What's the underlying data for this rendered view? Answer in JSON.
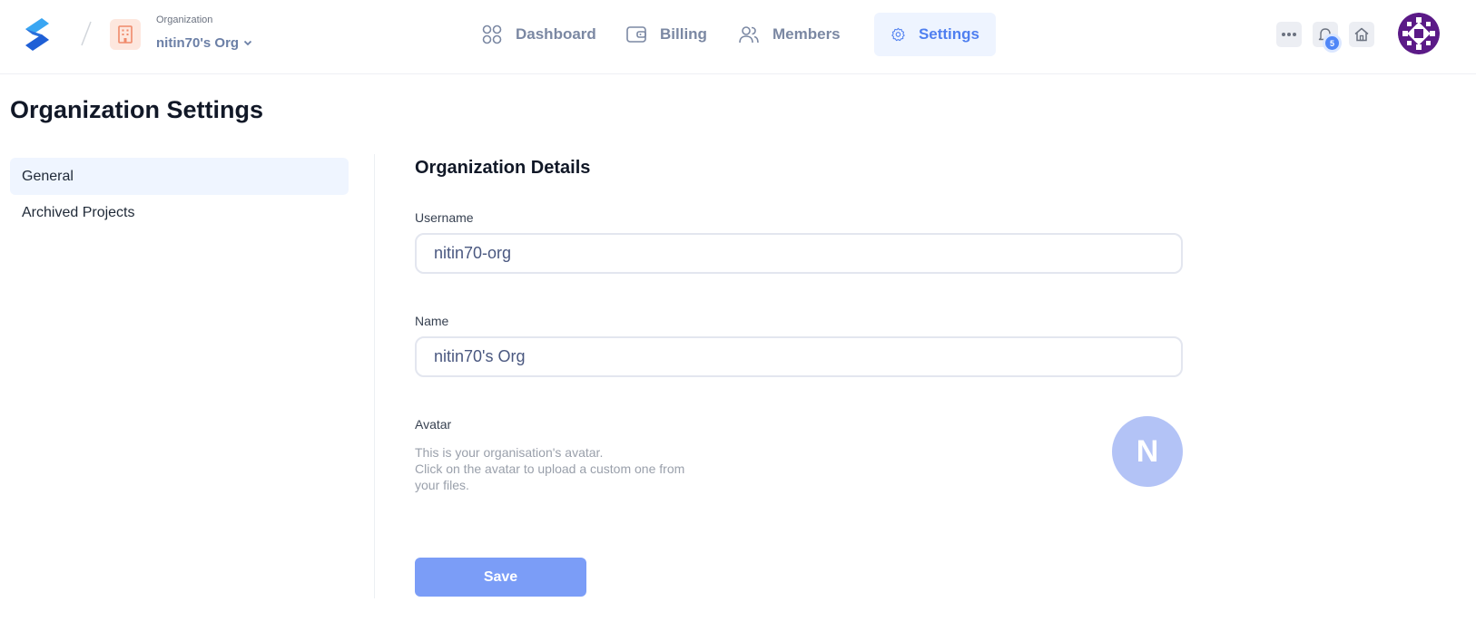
{
  "header": {
    "org_caption": "Organization",
    "org_name": "nitin70's Org",
    "nav": [
      {
        "label": "Dashboard",
        "icon": "grid-icon"
      },
      {
        "label": "Billing",
        "icon": "wallet-icon"
      },
      {
        "label": "Members",
        "icon": "users-icon"
      },
      {
        "label": "Settings",
        "icon": "gear-icon",
        "active": true
      }
    ],
    "notification_count": "5"
  },
  "page": {
    "title": "Organization Settings"
  },
  "sidebar": {
    "items": [
      {
        "label": "General",
        "active": true
      },
      {
        "label": "Archived Projects"
      }
    ]
  },
  "details": {
    "title": "Organization Details",
    "username_label": "Username",
    "username_value": "nitin70-org",
    "name_label": "Name",
    "name_value": "nitin70's Org",
    "avatar_label": "Avatar",
    "avatar_desc_1": "This is your organisation's avatar.",
    "avatar_desc_2": "Click on the avatar to upload a custom one from",
    "avatar_desc_3": "your files.",
    "avatar_initial": "N",
    "save_label": "Save"
  },
  "colors": {
    "accent": "#4f7ff0",
    "save_button": "#7b9df7",
    "avatar_bg": "#b3c3f6"
  }
}
